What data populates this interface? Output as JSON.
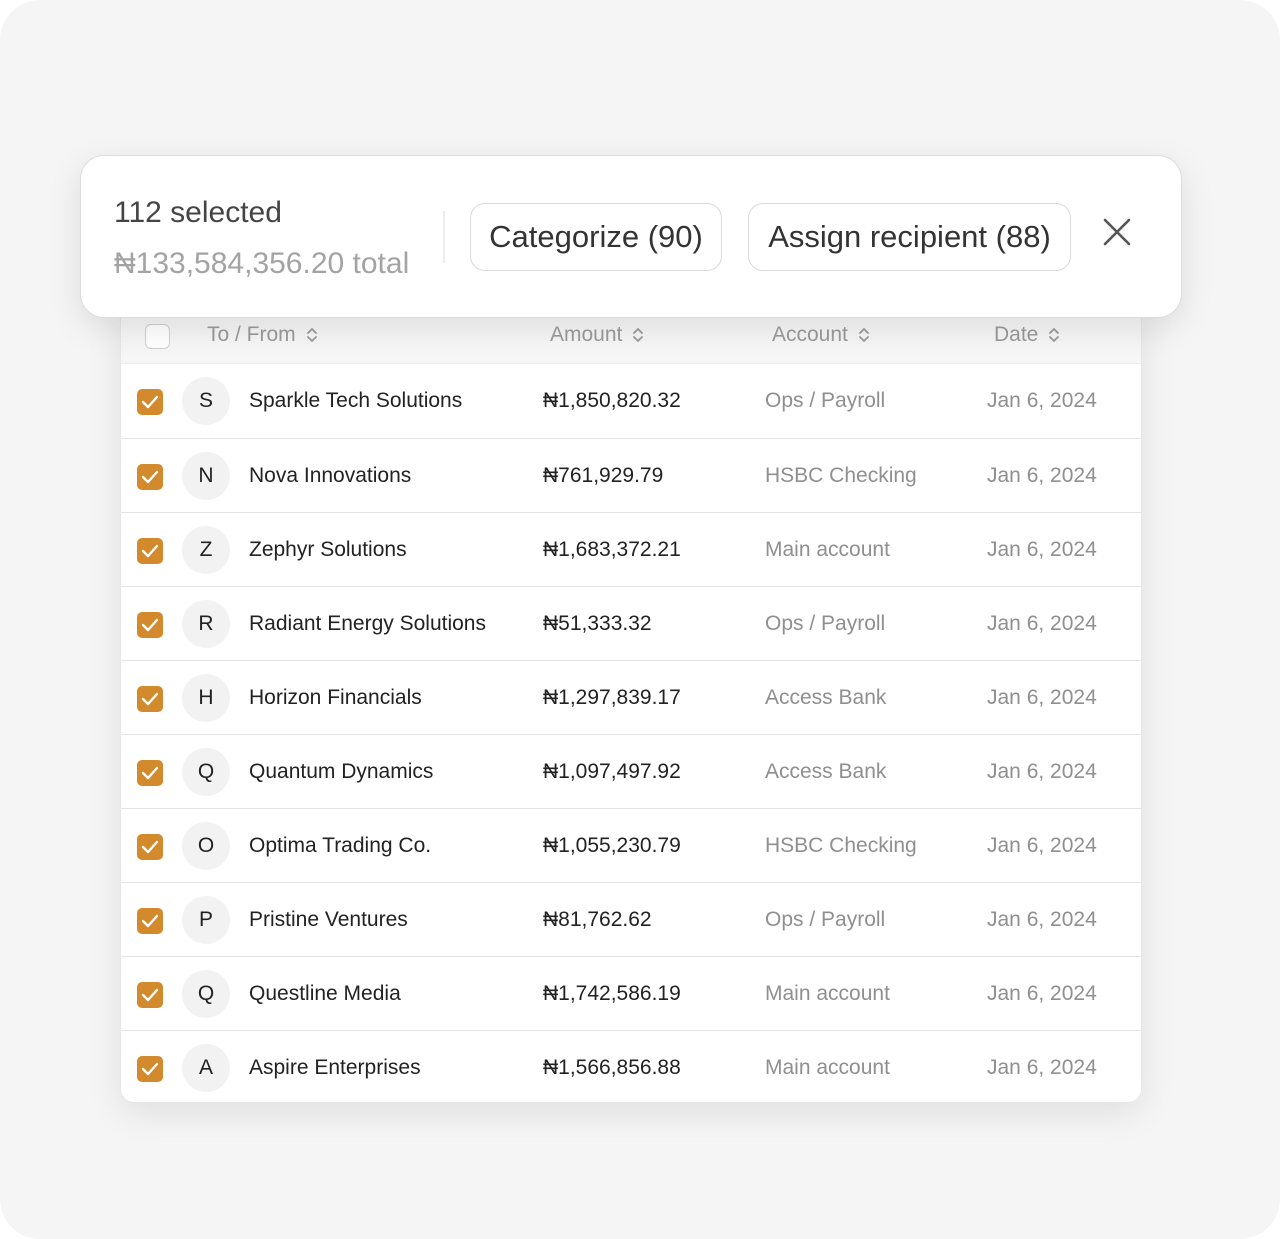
{
  "selection": {
    "count_label": "112 selected",
    "total_label": "₦133,584,356.20 total",
    "categorize_label": "Categorize (90)",
    "assign_label": "Assign recipient (88)",
    "close_icon": "close-icon"
  },
  "table": {
    "columns": {
      "to_from": "To / From",
      "amount": "Amount",
      "account": "Account",
      "date": "Date"
    },
    "rows": [
      {
        "initial": "S",
        "name": "Sparkle Tech Solutions",
        "amount": "₦1,850,820.32",
        "account": "Ops / Payroll",
        "date": "Jan 6, 2024",
        "checked": true
      },
      {
        "initial": "N",
        "name": "Nova Innovations",
        "amount": "₦761,929.79",
        "account": "HSBC Checking",
        "date": "Jan 6, 2024",
        "checked": true
      },
      {
        "initial": "Z",
        "name": "Zephyr Solutions",
        "amount": "₦1,683,372.21",
        "account": "Main account",
        "date": "Jan 6, 2024",
        "checked": true
      },
      {
        "initial": "R",
        "name": "Radiant Energy Solutions",
        "amount": "₦51,333.32",
        "account": "Ops / Payroll",
        "date": "Jan 6, 2024",
        "checked": true
      },
      {
        "initial": "H",
        "name": "Horizon Financials",
        "amount": "₦1,297,839.17",
        "account": "Access Bank",
        "date": "Jan 6, 2024",
        "checked": true
      },
      {
        "initial": "Q",
        "name": "Quantum Dynamics",
        "amount": "₦1,097,497.92",
        "account": "Access Bank",
        "date": "Jan 6, 2024",
        "checked": true
      },
      {
        "initial": "O",
        "name": "Optima Trading Co.",
        "amount": "₦1,055,230.79",
        "account": "HSBC Checking",
        "date": "Jan 6, 2024",
        "checked": true
      },
      {
        "initial": "P",
        "name": "Pristine Ventures",
        "amount": "₦81,762.62",
        "account": "Ops / Payroll",
        "date": "Jan 6, 2024",
        "checked": true
      },
      {
        "initial": "Q",
        "name": "Questline Media",
        "amount": "₦1,742,586.19",
        "account": "Main account",
        "date": "Jan 6, 2024",
        "checked": true
      },
      {
        "initial": "A",
        "name": "Aspire Enterprises",
        "amount": "₦1,566,856.88",
        "account": "Main account",
        "date": "Jan 6, 2024",
        "checked": true
      }
    ]
  },
  "colors": {
    "accent": "#d38a2c",
    "background": "#f5f5f5",
    "muted_text": "#8f8f8f"
  }
}
